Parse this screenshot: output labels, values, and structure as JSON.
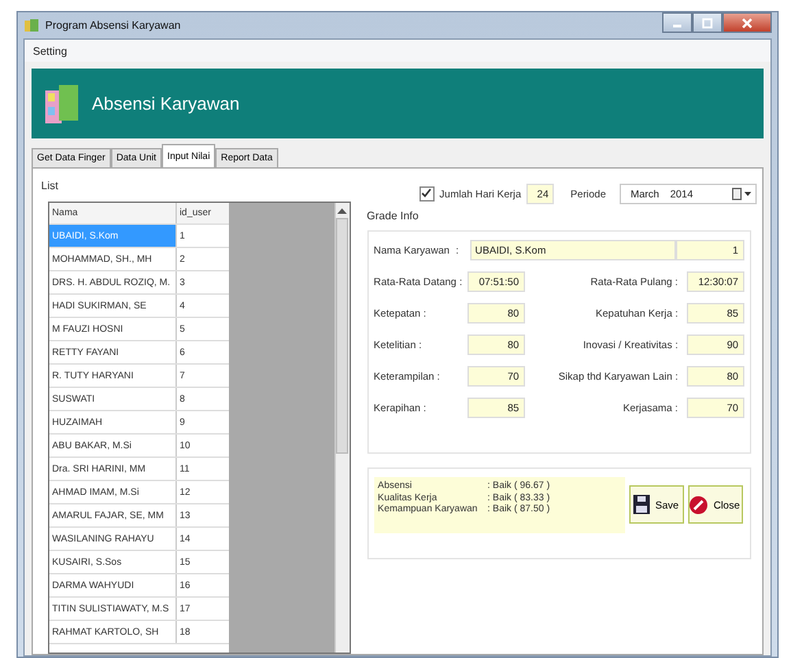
{
  "window": {
    "title": "Program Absensi Karyawan"
  },
  "menu": [
    "Setting"
  ],
  "banner": {
    "title": "Absensi Karyawan"
  },
  "tabs": [
    {
      "label": "Get Data Finger",
      "selected": false
    },
    {
      "label": "Data Unit",
      "selected": false
    },
    {
      "label": "Input Nilai",
      "selected": true
    },
    {
      "label": "Report Data",
      "selected": false
    }
  ],
  "list": {
    "title": "List",
    "columns": [
      "Nama",
      "id_user"
    ],
    "rows": [
      {
        "name": "UBAIDI, S.Kom",
        "id": "1",
        "selected": true
      },
      {
        "name": "MOHAMMAD, SH., MH",
        "id": "2",
        "selected": false
      },
      {
        "name": "DRS. H. ABDUL ROZIQ, M.",
        "id": "3",
        "selected": false
      },
      {
        "name": "HADI SUKIRMAN, SE",
        "id": "4",
        "selected": false
      },
      {
        "name": "M FAUZI HOSNI",
        "id": "5",
        "selected": false
      },
      {
        "name": "RETTY FAYANI",
        "id": "6",
        "selected": false
      },
      {
        "name": "R. TUTY HARYANI",
        "id": "7",
        "selected": false
      },
      {
        "name": "SUSWATI",
        "id": "8",
        "selected": false
      },
      {
        "name": "HUZAIMAH",
        "id": "9",
        "selected": false
      },
      {
        "name": "ABU BAKAR, M.Si",
        "id": "10",
        "selected": false
      },
      {
        "name": "Dra. SRI HARINI, MM",
        "id": "11",
        "selected": false
      },
      {
        "name": "AHMAD IMAM, M.Si",
        "id": "12",
        "selected": false
      },
      {
        "name": "AMARUL FAJAR, SE, MM",
        "id": "13",
        "selected": false
      },
      {
        "name": "WASILANING RAHAYU",
        "id": "14",
        "selected": false
      },
      {
        "name": "KUSAIRI, S.Sos",
        "id": "15",
        "selected": false
      },
      {
        "name": "DARMA WAHYUDI",
        "id": "16",
        "selected": false
      },
      {
        "name": "TITIN SULISTIAWATY, M.S",
        "id": "17",
        "selected": false
      },
      {
        "name": "RAHMAT KARTOLO, SH",
        "id": "18",
        "selected": false
      }
    ]
  },
  "work_days": {
    "label": "Jumlah Hari Kerja",
    "checked": true,
    "value": "24"
  },
  "period": {
    "label": "Periode",
    "month": "March",
    "year": "2014"
  },
  "grade_info": {
    "title": "Grade Info",
    "employee": {
      "label": "Nama Karyawan",
      "separator": ":",
      "name": "UBAIDI, S.Kom",
      "id": "1"
    },
    "rows": [
      {
        "left": {
          "label": "Rata-Rata Datang  :",
          "value": "07:51:50"
        },
        "right": {
          "label": "Rata-Rata Pulang  :",
          "value": "12:30:07"
        }
      },
      {
        "left": {
          "label": "Ketepatan :",
          "value": "80"
        },
        "right": {
          "label": "Kepatuhan Kerja :",
          "value": "85"
        }
      },
      {
        "left": {
          "label": "Ketelitian :",
          "value": "80"
        },
        "right": {
          "label": "Inovasi / Kreativitas :",
          "value": "90"
        }
      },
      {
        "left": {
          "label": "Keterampilan :",
          "value": "70"
        },
        "right": {
          "label": "Sikap thd Karyawan Lain :",
          "value": "80"
        }
      },
      {
        "left": {
          "label": "Kerapihan :",
          "value": "85"
        },
        "right": {
          "label": "Kerjasama :",
          "value": "70"
        }
      }
    ]
  },
  "summary": [
    {
      "label": "Absensi",
      "value": ": Baik ( 96.67 )"
    },
    {
      "label": "Kualitas Kerja",
      "value": ": Baik ( 83.33 )"
    },
    {
      "label": "Kemampuan Karyawan",
      "value": ": Baik ( 87.50 )"
    }
  ],
  "buttons": [
    {
      "kind": "save",
      "label": "Save"
    },
    {
      "kind": "close",
      "label": "Close"
    }
  ]
}
